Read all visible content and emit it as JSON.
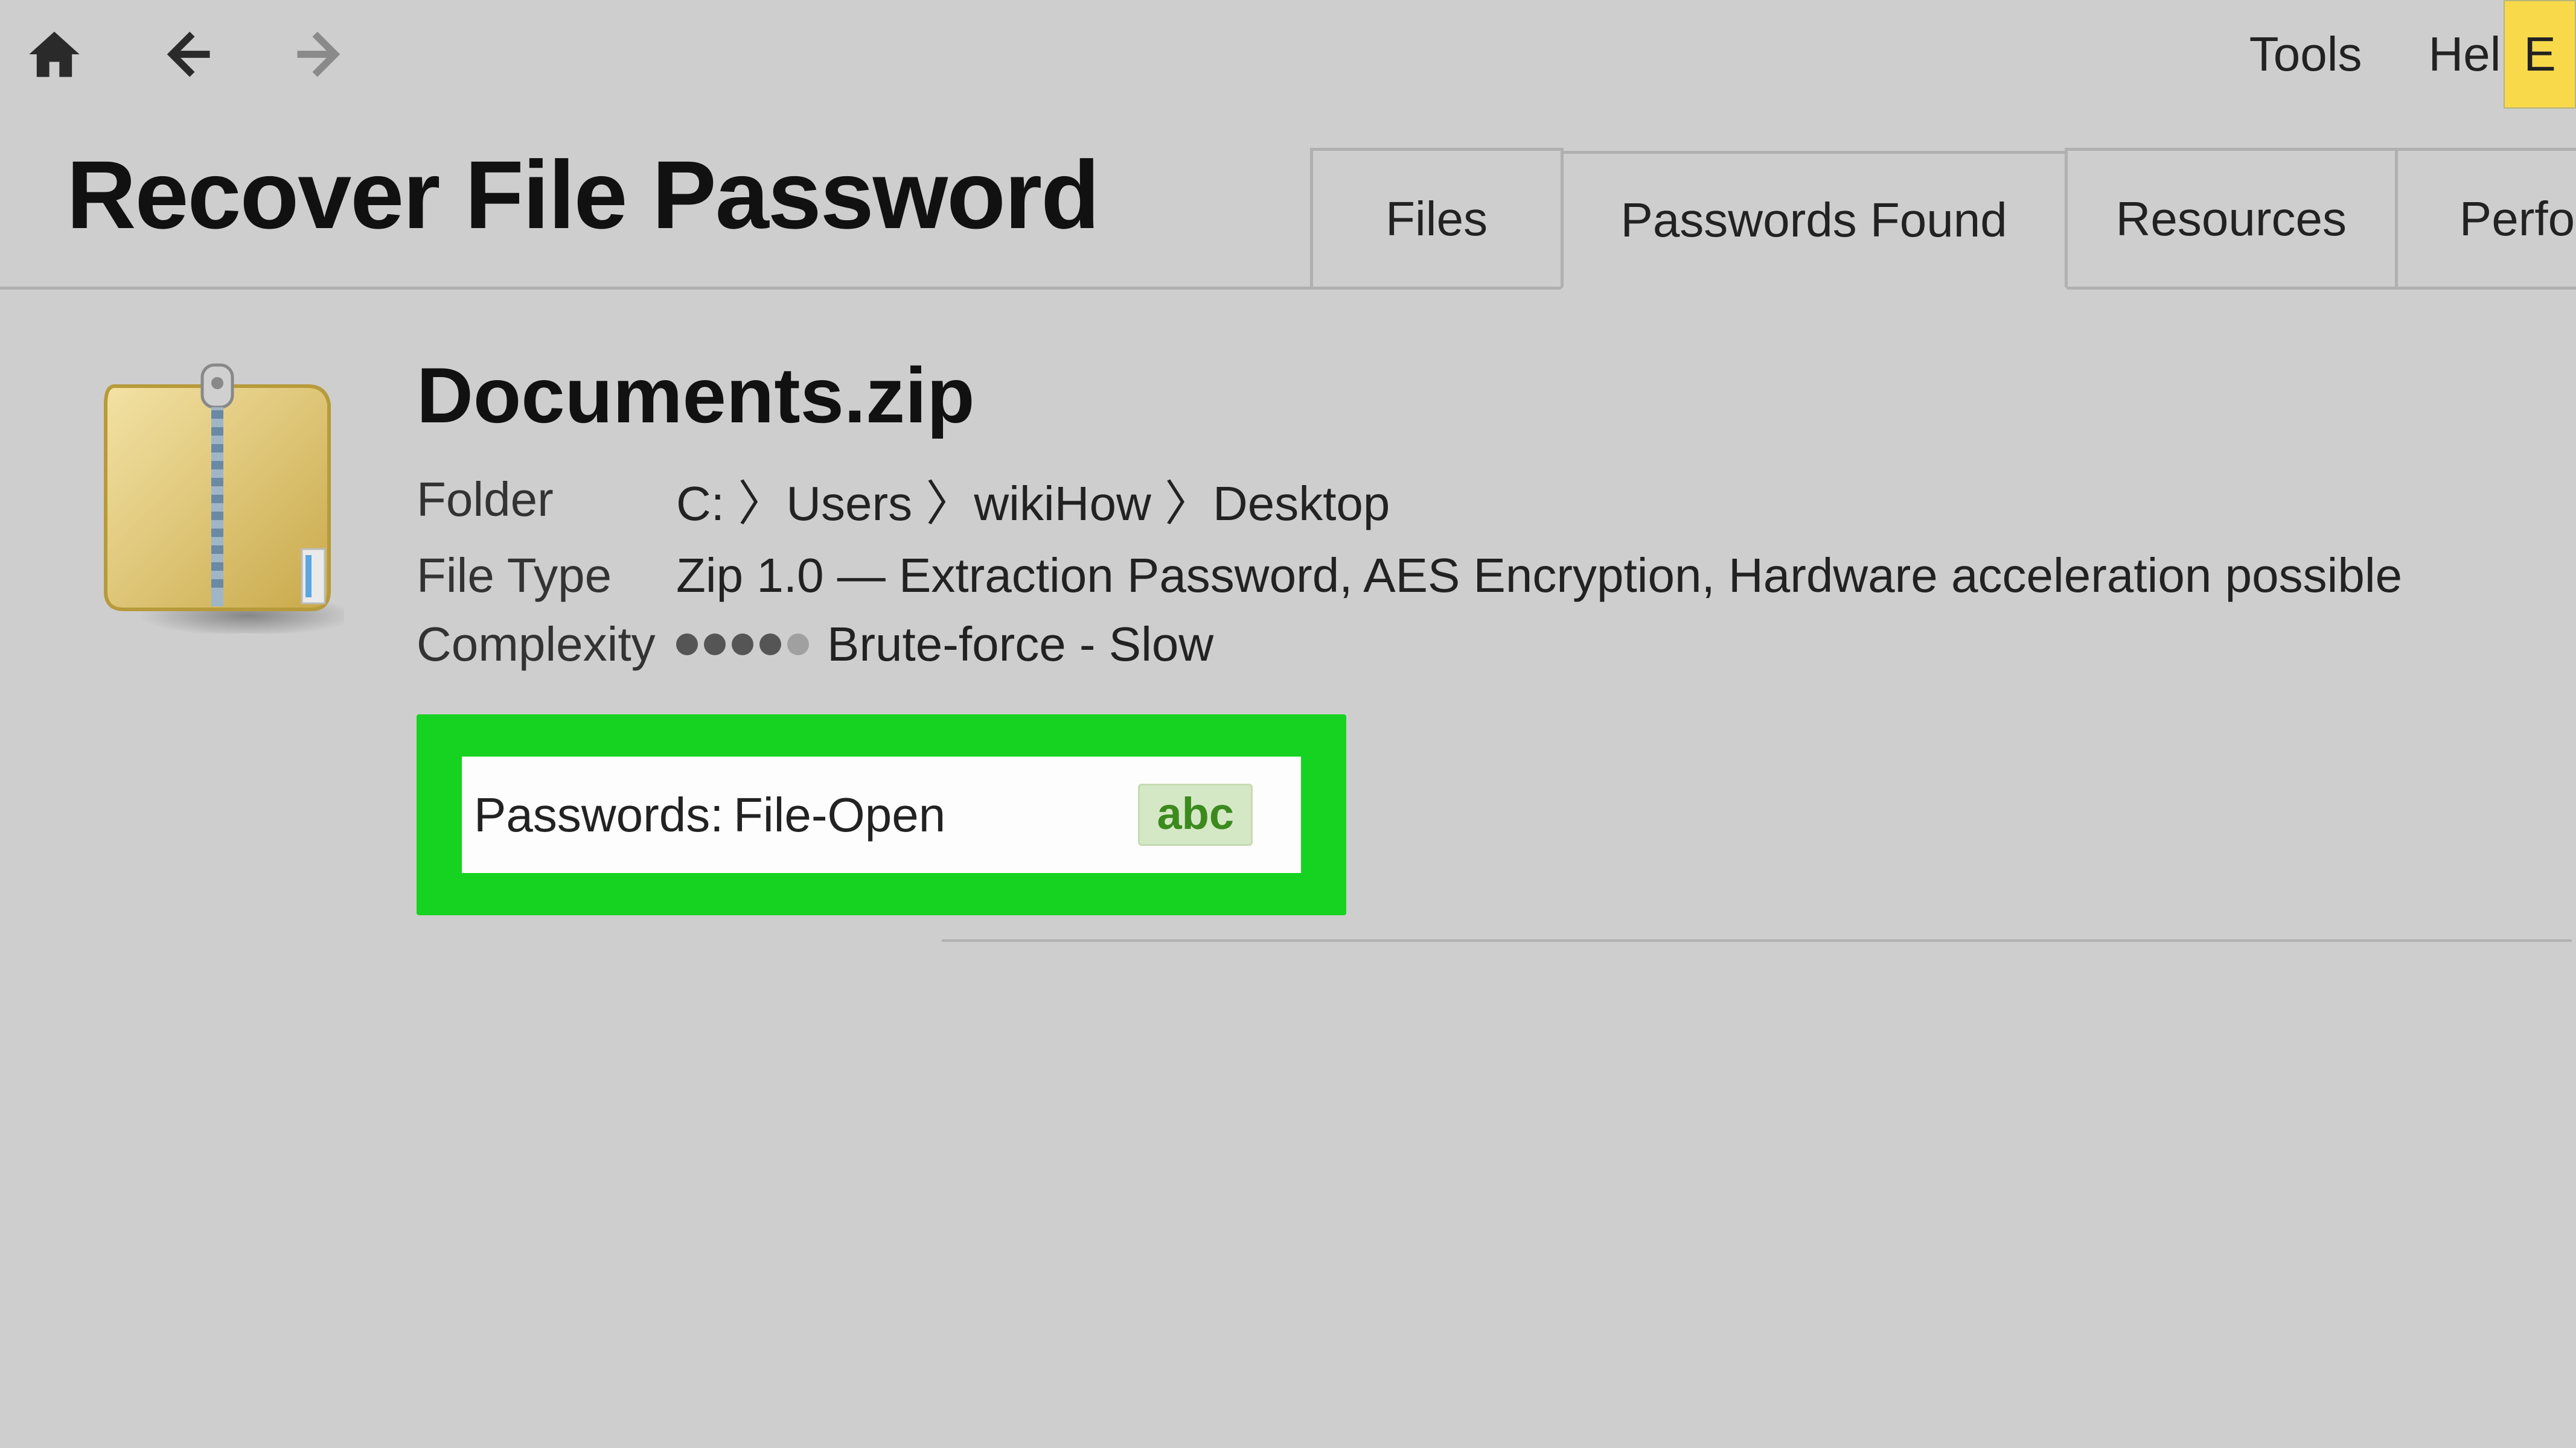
{
  "toolbar": {
    "menu": {
      "tools": "Tools",
      "help": "Help"
    },
    "yellow_button_label": "E"
  },
  "page": {
    "title": "Recover File Password"
  },
  "tabs": [
    {
      "label": "Files"
    },
    {
      "label": "Passwords Found"
    },
    {
      "label": "Resources"
    },
    {
      "label": "Perfo"
    }
  ],
  "file": {
    "name": "Documents.zip",
    "folder_label": "Folder",
    "folder_value": "C: 〉Users 〉wikiHow 〉Desktop",
    "filetype_label": "File Type",
    "filetype_value": "Zip 1.0 — Extraction Password, AES Encryption, Hardware acceleration possible",
    "complexity_label": "Complexity",
    "complexity_value": "Brute-force - Slow",
    "complexity_dots_filled": 4,
    "complexity_dots_total": 5
  },
  "passwords": {
    "label": "Passwords:",
    "value": "File-Open",
    "badge": "abc"
  },
  "colors": {
    "highlight_green": "#17d321",
    "badge_bg": "#d5e8c5",
    "badge_text": "#3c8a1e",
    "yellow": "#f8d94a"
  }
}
